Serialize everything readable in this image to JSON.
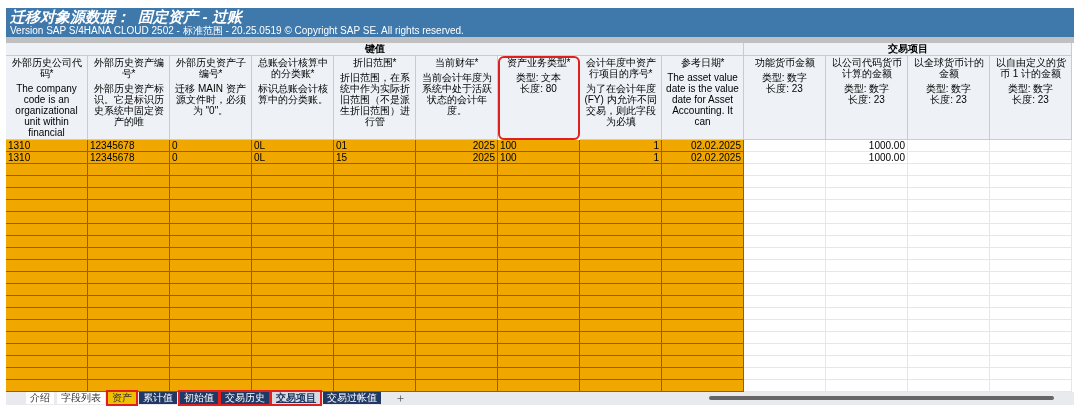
{
  "title": "迁移对象源数据：  固定资产 - 过账",
  "subtitle": "Version SAP S/4HANA CLOUD 2502 - 标准范围 - 20.25.0519 © Copyright SAP SE. All rights reserved.",
  "groups": [
    {
      "title": "键值",
      "kind": "key",
      "columns": [
        {
          "title": "外部历史公司代码*",
          "description": [
            "The company code is an organizational unit within financial"
          ],
          "kind": "text",
          "highlighted": false
        },
        {
          "title": "外部历史资产编号*",
          "description": [
            "外部历史资产标识。它是标识历史系统中固定资产的唯"
          ],
          "kind": "text",
          "highlighted": false
        },
        {
          "title": "外部历史资产子编号*",
          "description": [
            "迁移 MAIN 资产源文件时，必须为 \"0\"。"
          ],
          "kind": "text",
          "highlighted": false
        },
        {
          "title": "总账会计核算中的分类账*",
          "description": [
            "标识总账会计核算中的分类账。"
          ],
          "kind": "text",
          "highlighted": false
        },
        {
          "title": "折旧范围*",
          "description": [
            "折旧范围，在系统中作为实际折旧范围（不是派生折旧范围）进行管"
          ],
          "kind": "text",
          "highlighted": false
        },
        {
          "title": "当前财年*",
          "description": [
            "当前会计年度为系统中处于活跃状态的会计年度。"
          ],
          "kind": "number",
          "highlighted": false
        },
        {
          "title": "资产业务类型*",
          "description": [
            "类型: 文本",
            "长度: 80"
          ],
          "kind": "text",
          "highlighted": true
        },
        {
          "title": "会计年度中资产行项目的序号*",
          "description": [
            "为了在会计年度 (FY) 内允许不同交易，则此字段为必填"
          ],
          "kind": "number",
          "highlighted": false
        },
        {
          "title": "参考日期*",
          "description": [
            "The asset value date is the value date for Asset Accounting. It can"
          ],
          "kind": "number",
          "highlighted": false
        }
      ]
    },
    {
      "title": "交易项目",
      "kind": "transaction",
      "columns": [
        {
          "title": "功能货币金额",
          "description": [
            "类型: 数字",
            "长度: 23"
          ],
          "kind": "number",
          "highlighted": false
        },
        {
          "title": "以公司代码货币计算的金额",
          "description": [
            "类型: 数字",
            "长度: 23"
          ],
          "kind": "number",
          "highlighted": false
        },
        {
          "title": "以全球货币计的金额",
          "description": [
            "类型: 数字",
            "长度: 23"
          ],
          "kind": "number",
          "highlighted": false
        },
        {
          "title": "以自由定义的货币 1 计的金额",
          "description": [
            "类型: 数字",
            "长度: 23"
          ],
          "kind": "number",
          "highlighted": false
        }
      ]
    }
  ],
  "rows": [
    [
      "1310",
      "12345678",
      "0",
      "0L",
      "01",
      "2025",
      "100",
      "1",
      "02.02.2025",
      "",
      "1000.00",
      "",
      ""
    ],
    [
      "1310",
      "12345678",
      "0",
      "0L",
      "15",
      "2025",
      "100",
      "1",
      "02.02.2025",
      "",
      "1000.00",
      "",
      ""
    ]
  ],
  "sheet_tabs": [
    {
      "label": "介绍",
      "selected": false,
      "color": "#ffffff",
      "highlighted": false
    },
    {
      "label": "字段列表",
      "selected": false,
      "color": "#ffffff",
      "highlighted": false
    },
    {
      "label": "资产",
      "selected": false,
      "color": "#f0c000",
      "highlighted": true
    },
    {
      "label": "累计值",
      "selected": false,
      "color": "#1f3864",
      "highlighted": false
    },
    {
      "label": "初始值",
      "selected": false,
      "color": "#1f3864",
      "highlighted": true
    },
    {
      "label": "交易历史",
      "selected": false,
      "color": "#1f3864",
      "highlighted": true
    },
    {
      "label": "交易项目",
      "selected": true,
      "color": "#1f3864",
      "highlighted": true
    },
    {
      "label": "交易过帐值",
      "selected": false,
      "color": "#1f3864",
      "highlighted": false
    }
  ]
}
